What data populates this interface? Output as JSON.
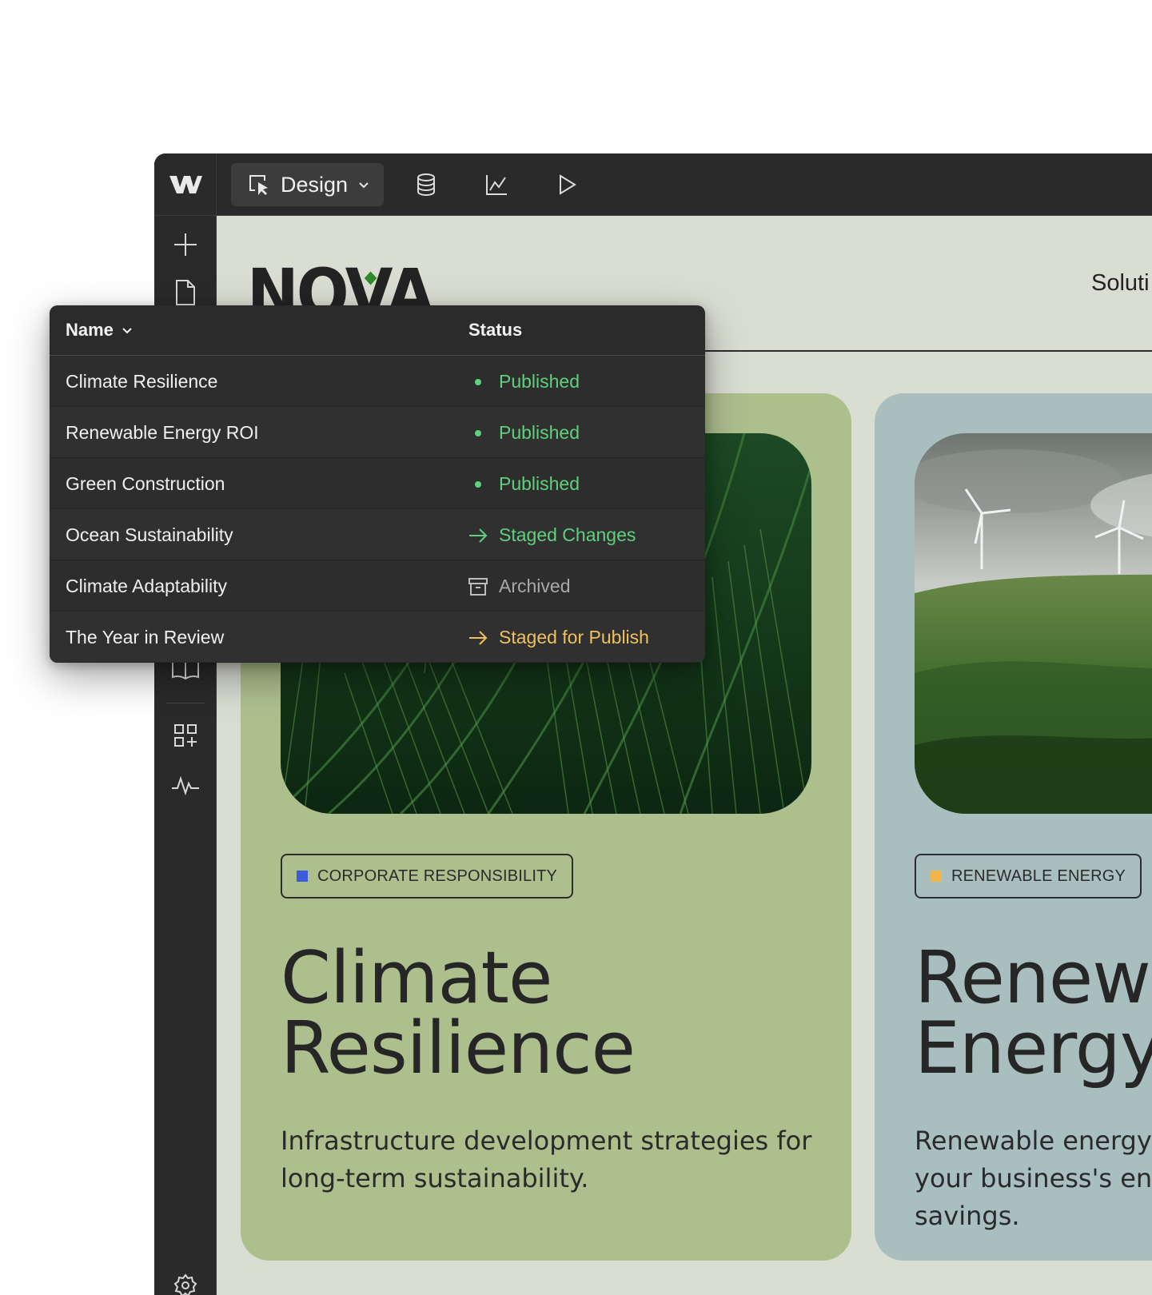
{
  "app": {
    "mode_label": "Design"
  },
  "site": {
    "brand": "NOVA",
    "nav_link": "Soluti"
  },
  "table": {
    "columns": {
      "name": "Name",
      "status": "Status"
    },
    "rows": [
      {
        "name": "Climate Resilience",
        "status": "Published",
        "kind": "published"
      },
      {
        "name": "Renewable Energy ROI",
        "status": "Published",
        "kind": "published"
      },
      {
        "name": "Green Construction",
        "status": "Published",
        "kind": "published"
      },
      {
        "name": "Ocean Sustainability",
        "status": "Staged Changes",
        "kind": "staged"
      },
      {
        "name": "Climate Adaptability",
        "status": "Archived",
        "kind": "archived"
      },
      {
        "name": "The Year in Review",
        "status": "Staged for Publish",
        "kind": "publish"
      }
    ]
  },
  "cards": [
    {
      "tag": "CORPORATE RESPONSIBILITY",
      "tag_color": "#3b5bdb",
      "title_line1": "Climate",
      "title_line2": "Resilience",
      "desc_line1": "Infrastructure development strategies for",
      "desc_line2": "long-term sustainability."
    },
    {
      "tag": "RENEWABLE ENERGY",
      "tag_color": "#f0b44a",
      "title_line1": "Renewa",
      "title_line2": "Energy",
      "desc_line1": "Renewable energy",
      "desc_line2": "your business's ene",
      "desc_line3": "savings."
    }
  ],
  "colors": {
    "published": "#5fd17c",
    "staged": "#5fd17c",
    "archived": "#a9a9a9",
    "publish": "#f0c060",
    "chrome": "#2a2a2a",
    "canvas": "#d9ddd2"
  },
  "icons": {
    "logo": "webflow-logo-icon",
    "design": "cursor-select-icon",
    "cms": "database-icon",
    "analytics": "chart-line-icon",
    "preview": "play-icon"
  }
}
